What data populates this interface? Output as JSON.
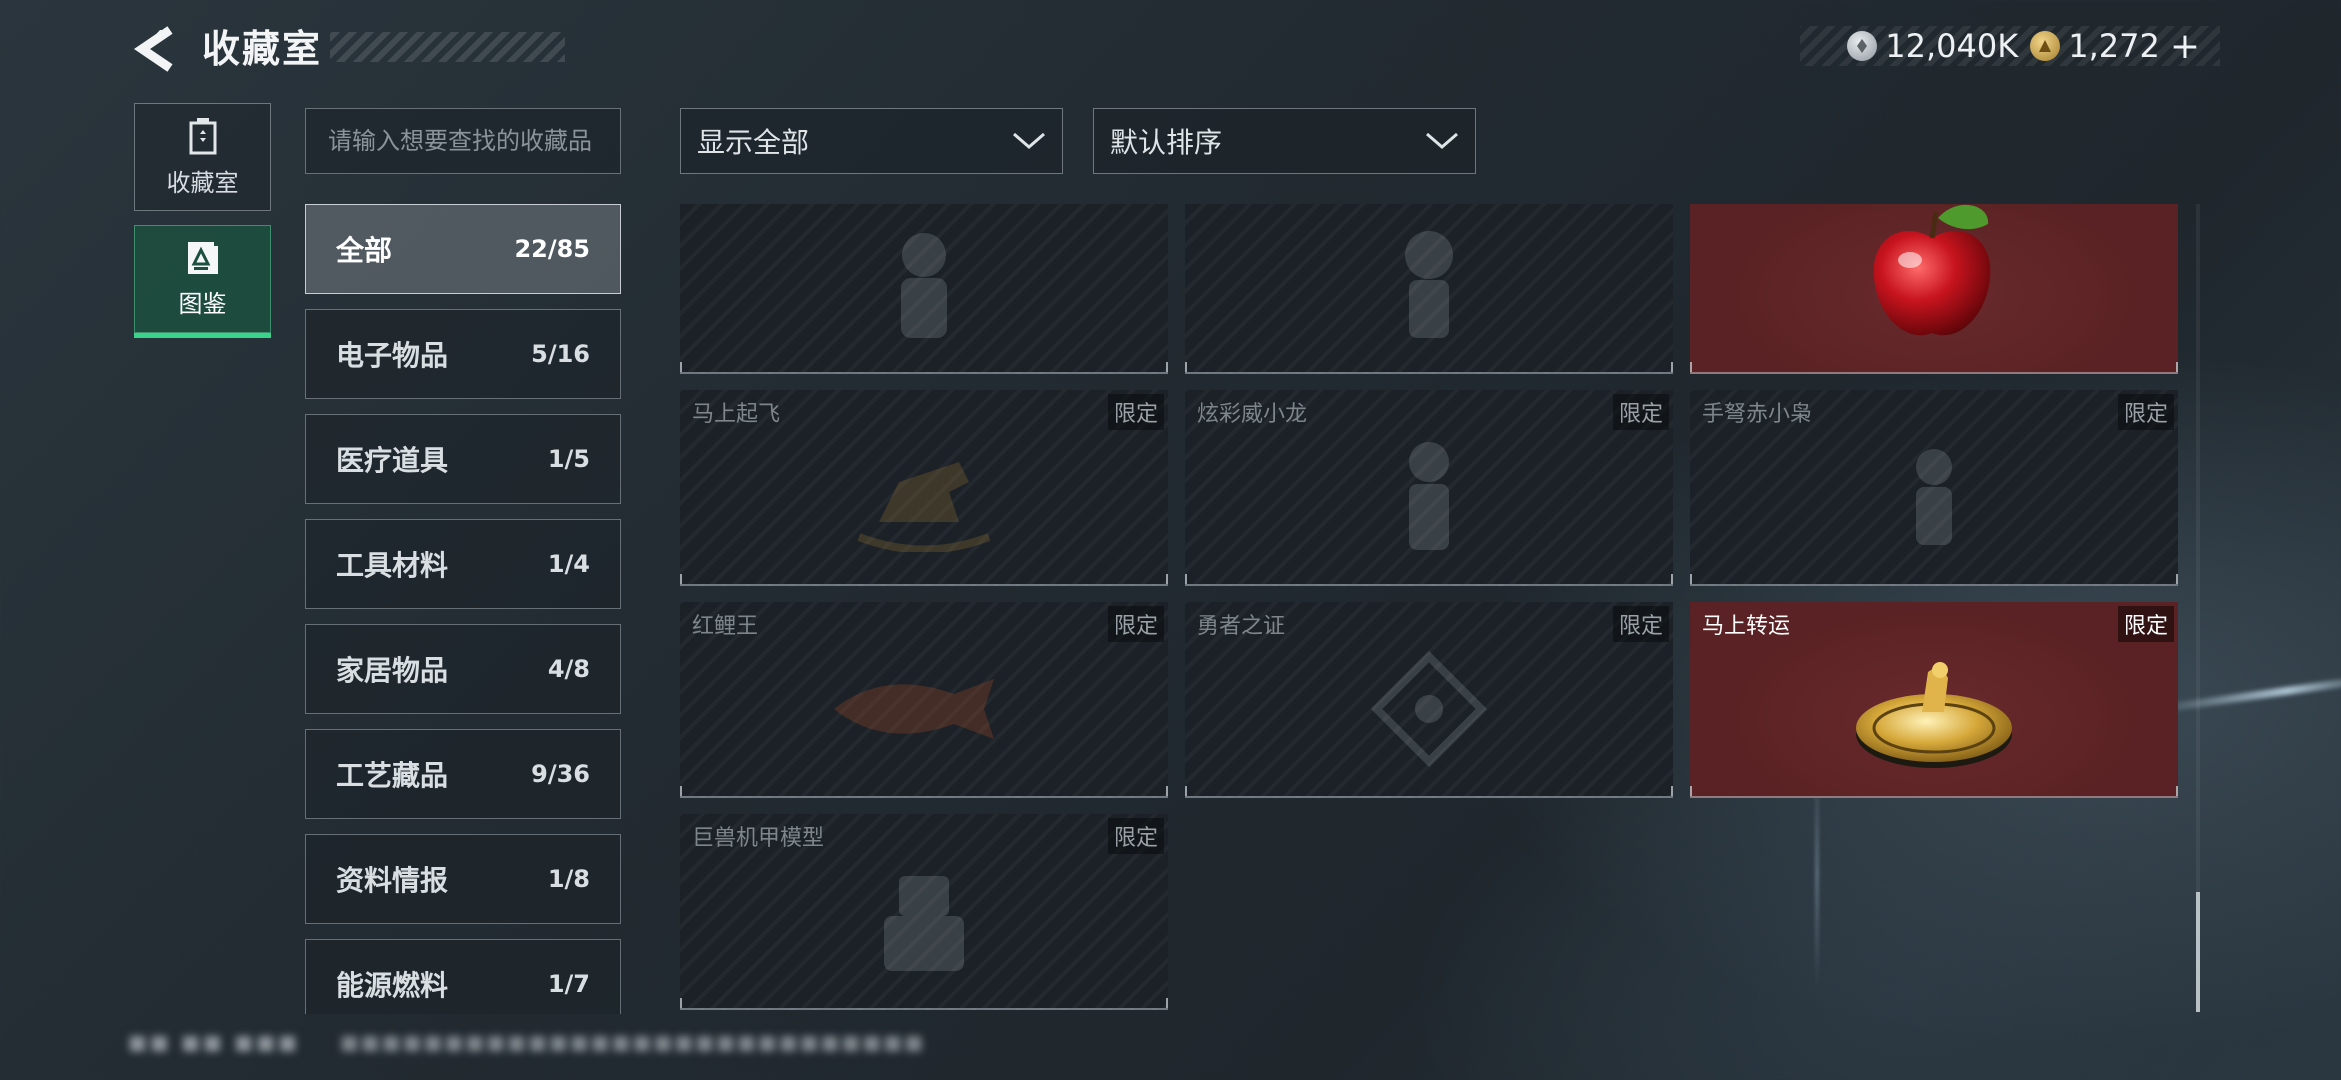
{
  "header": {
    "title": "收藏室",
    "currencies": [
      {
        "icon": "silver-coin-icon",
        "value": "12,040K"
      },
      {
        "icon": "gold-coin-icon",
        "value": "1,272"
      }
    ],
    "plus_label": "+"
  },
  "side_nav": [
    {
      "label": "收藏室",
      "icon": "collection-room-icon",
      "active": false
    },
    {
      "label": "图鉴",
      "icon": "catalog-icon",
      "active": true
    }
  ],
  "search": {
    "placeholder": "请输入想要查找的收藏品"
  },
  "categories": [
    {
      "name": "全部",
      "count": "22/85",
      "active": true
    },
    {
      "name": "电子物品",
      "count": "5/16"
    },
    {
      "name": "医疗道具",
      "count": "1/5"
    },
    {
      "name": "工具材料",
      "count": "1/4"
    },
    {
      "name": "家居物品",
      "count": "4/8"
    },
    {
      "name": "工艺藏品",
      "count": "9/36"
    },
    {
      "name": "资料情报",
      "count": "1/8"
    },
    {
      "name": "能源燃料",
      "count": "1/7"
    }
  ],
  "filters": {
    "show": "显示全部",
    "sort": "默认排序"
  },
  "items": [
    {
      "name": "",
      "badge": "",
      "owned": false,
      "icon": "figure-icon"
    },
    {
      "name": "",
      "badge": "",
      "owned": false,
      "icon": "skull-figure-icon"
    },
    {
      "name": "",
      "badge": "",
      "owned": true,
      "icon": "apple-icon"
    },
    {
      "name": "马上起飞",
      "badge": "限定",
      "owned": false,
      "icon": "rocking-horse-icon"
    },
    {
      "name": "炫彩威小龙",
      "badge": "限定",
      "owned": false,
      "icon": "dragon-figure-icon"
    },
    {
      "name": "手弩赤小枭",
      "badge": "限定",
      "owned": false,
      "icon": "owl-figure-icon"
    },
    {
      "name": "红鲤王",
      "badge": "限定",
      "owned": false,
      "icon": "carp-icon"
    },
    {
      "name": "勇者之证",
      "badge": "限定",
      "owned": false,
      "icon": "badge-plaque-icon"
    },
    {
      "name": "马上转运",
      "badge": "限定",
      "owned": true,
      "icon": "golden-horse-medallion-icon"
    },
    {
      "name": "巨兽机甲模型",
      "badge": "限定",
      "owned": false,
      "icon": "mecha-model-icon"
    }
  ],
  "footer": {
    "left": "■■ ■■ ■■■",
    "right": "■■■■■■■■■■■■■■■■■■■■■■■■■■■■"
  }
}
